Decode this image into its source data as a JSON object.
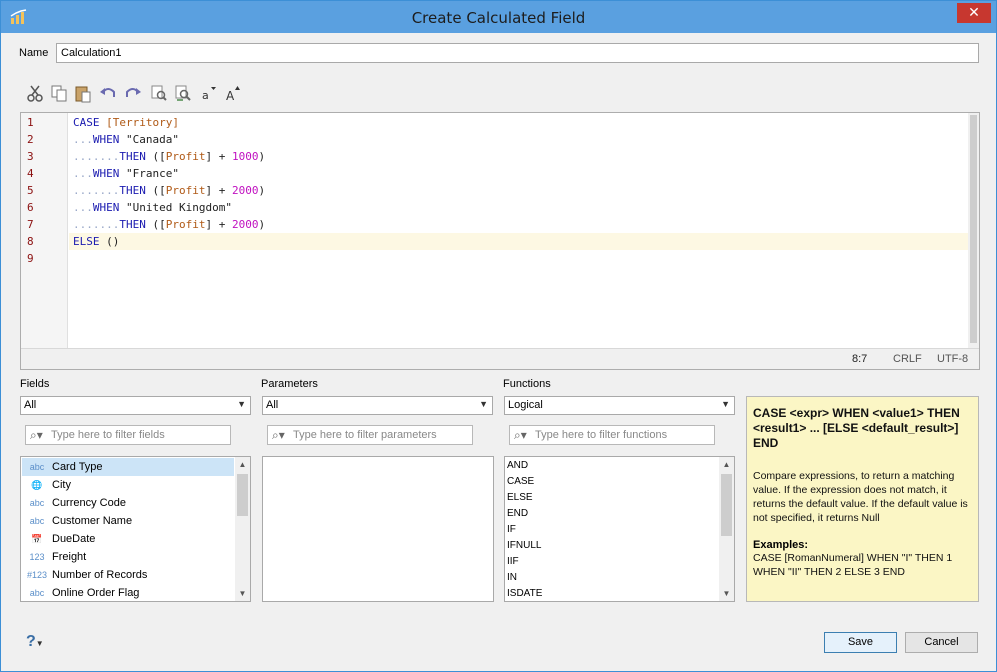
{
  "window": {
    "title": "Create Calculated Field",
    "close_label": "✕"
  },
  "name_field": {
    "label": "Name",
    "value": "Calculation1"
  },
  "toolbar": {
    "icons": [
      "cut-icon",
      "copy-icon",
      "paste-icon",
      "undo-icon",
      "redo-icon",
      "find-icon",
      "find-replace-icon",
      "decrease-font-icon",
      "increase-font-icon"
    ]
  },
  "editor": {
    "line_numbers": [
      "1",
      "2",
      "3",
      "4",
      "5",
      "6",
      "7",
      "8",
      "9"
    ],
    "lines": [
      [
        {
          "t": "kw",
          "v": "CASE"
        },
        {
          "t": "str",
          "v": " "
        },
        {
          "t": "fld",
          "v": "[Territory]"
        }
      ],
      [
        {
          "t": "dots",
          "v": "..."
        },
        {
          "t": "kw",
          "v": "WHEN"
        },
        {
          "t": "str",
          "v": " \"Canada\""
        }
      ],
      [
        {
          "t": "dots",
          "v": "......."
        },
        {
          "t": "kw",
          "v": "THEN"
        },
        {
          "t": "str",
          "v": " (["
        },
        {
          "t": "fld",
          "v": "Profit"
        },
        {
          "t": "str",
          "v": "] + "
        },
        {
          "t": "num",
          "v": "1000"
        },
        {
          "t": "str",
          "v": ")"
        }
      ],
      [
        {
          "t": "dots",
          "v": "..."
        },
        {
          "t": "kw",
          "v": "WHEN"
        },
        {
          "t": "str",
          "v": " \"France\""
        }
      ],
      [
        {
          "t": "dots",
          "v": "......."
        },
        {
          "t": "kw",
          "v": "THEN"
        },
        {
          "t": "str",
          "v": " (["
        },
        {
          "t": "fld",
          "v": "Profit"
        },
        {
          "t": "str",
          "v": "] + "
        },
        {
          "t": "num",
          "v": "2000"
        },
        {
          "t": "str",
          "v": ")"
        }
      ],
      [
        {
          "t": "dots",
          "v": "..."
        },
        {
          "t": "kw",
          "v": "WHEN"
        },
        {
          "t": "str",
          "v": " \"United Kingdom\""
        }
      ],
      [
        {
          "t": "dots",
          "v": "......."
        },
        {
          "t": "kw",
          "v": "THEN"
        },
        {
          "t": "str",
          "v": " (["
        },
        {
          "t": "fld",
          "v": "Profit"
        },
        {
          "t": "str",
          "v": "] + "
        },
        {
          "t": "num",
          "v": "2000"
        },
        {
          "t": "str",
          "v": ")"
        }
      ],
      [
        {
          "t": "kw",
          "v": "ELSE"
        },
        {
          "t": "str",
          "v": " ()"
        }
      ],
      []
    ],
    "highlight_line": 8,
    "status": {
      "position": "8:7",
      "line_ending": "CRLF",
      "encoding": "UTF-8"
    }
  },
  "fields": {
    "label": "Fields",
    "dropdown": "All",
    "filter_placeholder": "Type here to filter fields",
    "items": [
      {
        "type": "abc",
        "name": "Card Type",
        "icon": "string-type-icon"
      },
      {
        "type": "🌐",
        "name": "City",
        "icon": "geo-type-icon"
      },
      {
        "type": "abc",
        "name": "Currency Code",
        "icon": "string-type-icon"
      },
      {
        "type": "abc",
        "name": "Customer Name",
        "icon": "string-type-icon"
      },
      {
        "type": "📅",
        "name": "DueDate",
        "icon": "date-type-icon"
      },
      {
        "type": "123",
        "name": "Freight",
        "icon": "number-type-icon"
      },
      {
        "type": "#123",
        "name": "Number of Records",
        "icon": "calc-number-type-icon"
      },
      {
        "type": "abc",
        "name": "Online Order Flag",
        "icon": "string-type-icon"
      }
    ]
  },
  "parameters": {
    "label": "Parameters",
    "dropdown": "All",
    "filter_placeholder": "Type here to filter parameters"
  },
  "functions": {
    "label": "Functions",
    "dropdown": "Logical",
    "filter_placeholder": "Type here to filter functions",
    "items": [
      "AND",
      "CASE",
      "ELSE",
      "END",
      "IF",
      "IFNULL",
      "IIF",
      "IN",
      "ISDATE"
    ]
  },
  "help": {
    "syntax": "CASE <expr> WHEN <value1> THEN <result1> ... [ELSE <default_result>] END",
    "description": "Compare expressions, to return a matching value. If the expression does not match, it returns the default value. If the default value is not specified, it returns Null",
    "examples_title": "Examples:",
    "example": "CASE [RomanNumeral] WHEN \"I\" THEN 1 WHEN \"II\" THEN 2 ELSE 3 END"
  },
  "footer": {
    "help_label": "?",
    "save_label": "Save",
    "cancel_label": "Cancel"
  }
}
